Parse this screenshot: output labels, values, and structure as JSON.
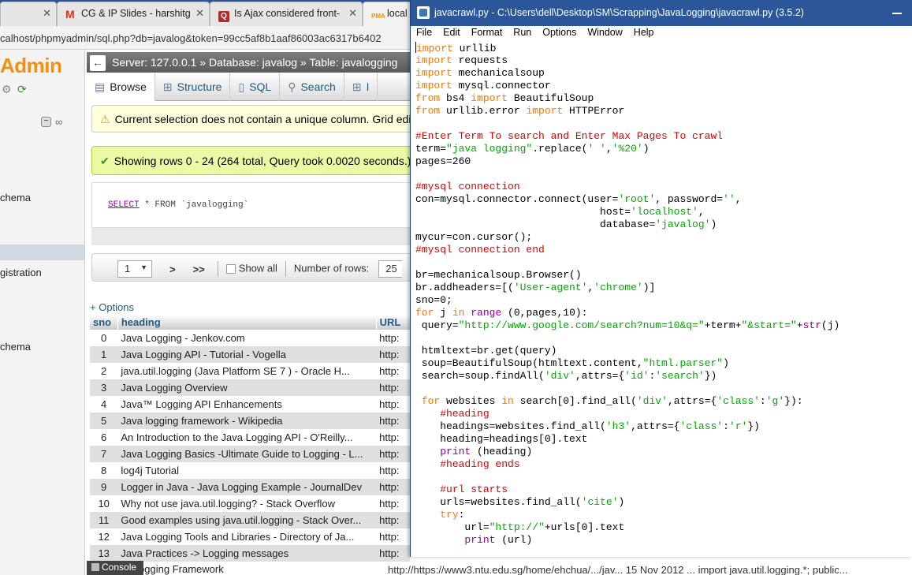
{
  "browser": {
    "tabs": [
      {
        "label": "",
        "favicon": "blank"
      },
      {
        "label": "CG & IP Slides - harshitg",
        "favicon": "gmail-icon"
      },
      {
        "label": "Is Ajax considered front-",
        "favicon": "quora-icon"
      },
      {
        "label": "local",
        "favicon": "pma-icon"
      }
    ],
    "address": "calhost/phpmyadmin/sql.php?db=javalog&token=99cc5af8b1aaf86003ac6317b6402"
  },
  "pma": {
    "logo": "Admin",
    "nav_items": [
      "chema",
      "gistration",
      "chema"
    ],
    "breadcrumb": "Server: 127.0.0.1 » Database: javalog » Table: javalogging",
    "tabs": [
      "Browse",
      "Structure",
      "SQL",
      "Search",
      "I"
    ],
    "notice": "Current selection does not contain a unique column. Grid edit, c",
    "success": "Showing rows 0 - 24 (264 total, Query took 0.0020 seconds.)",
    "sql_select": "SELECT",
    "sql_rest": " * FROM `javalogging`",
    "pager": {
      "page": "1",
      "next": ">",
      "last": ">>",
      "show_all": "Show all",
      "rows_label": "Number of rows:",
      "rows_value": "25"
    },
    "options": "+ Options",
    "columns": [
      "sno",
      "heading",
      "URL"
    ],
    "rows": [
      [
        "0",
        "Java Logging - Jenkov.com",
        "http:"
      ],
      [
        "1",
        "Java Logging API - Tutorial - Vogella",
        "http:"
      ],
      [
        "2",
        "java.util.logging (Java Platform SE 7 ) - Oracle H...",
        "http:"
      ],
      [
        "3",
        "Java Logging Overview",
        "http:"
      ],
      [
        "4",
        "Java™ Logging API Enhancements",
        "http:"
      ],
      [
        "5",
        "Java logging framework - Wikipedia",
        "http:"
      ],
      [
        "6",
        "An Introduction to the Java Logging API - O'Reilly...",
        "http:"
      ],
      [
        "7",
        "Java Logging Basics -Ultimate Guide to Logging - L...",
        "http:"
      ],
      [
        "8",
        "log4j Tutorial",
        "http:"
      ],
      [
        "9",
        "Logger in Java - Java Logging Example - JournalDev",
        "http:"
      ],
      [
        "10",
        "Why not use java.util.logging? - Stack Overflow",
        "http:"
      ],
      [
        "11",
        "Good examples using java.util.logging - Stack Over...",
        "http:"
      ],
      [
        "12",
        "Java Logging Tools and Libraries - Directory of Ja...",
        "http:"
      ],
      [
        "13",
        "Java Practices -> Logging messages",
        "http:"
      ]
    ],
    "partial_row": "a Logging Framework",
    "bottom_row": "http://https://www3.ntu.edu.sg/home/ehchua/.../jav...      15 Nov 2012 ... import java.util.logging.*; public...",
    "console": "Console"
  },
  "idle": {
    "title": "javacrawl.py - C:\\Users\\dell\\Desktop\\SM\\Scrapping\\JavaLogging\\javacrawl.py (3.5.2)",
    "menu": [
      "File",
      "Edit",
      "Format",
      "Run",
      "Options",
      "Window",
      "Help"
    ]
  }
}
